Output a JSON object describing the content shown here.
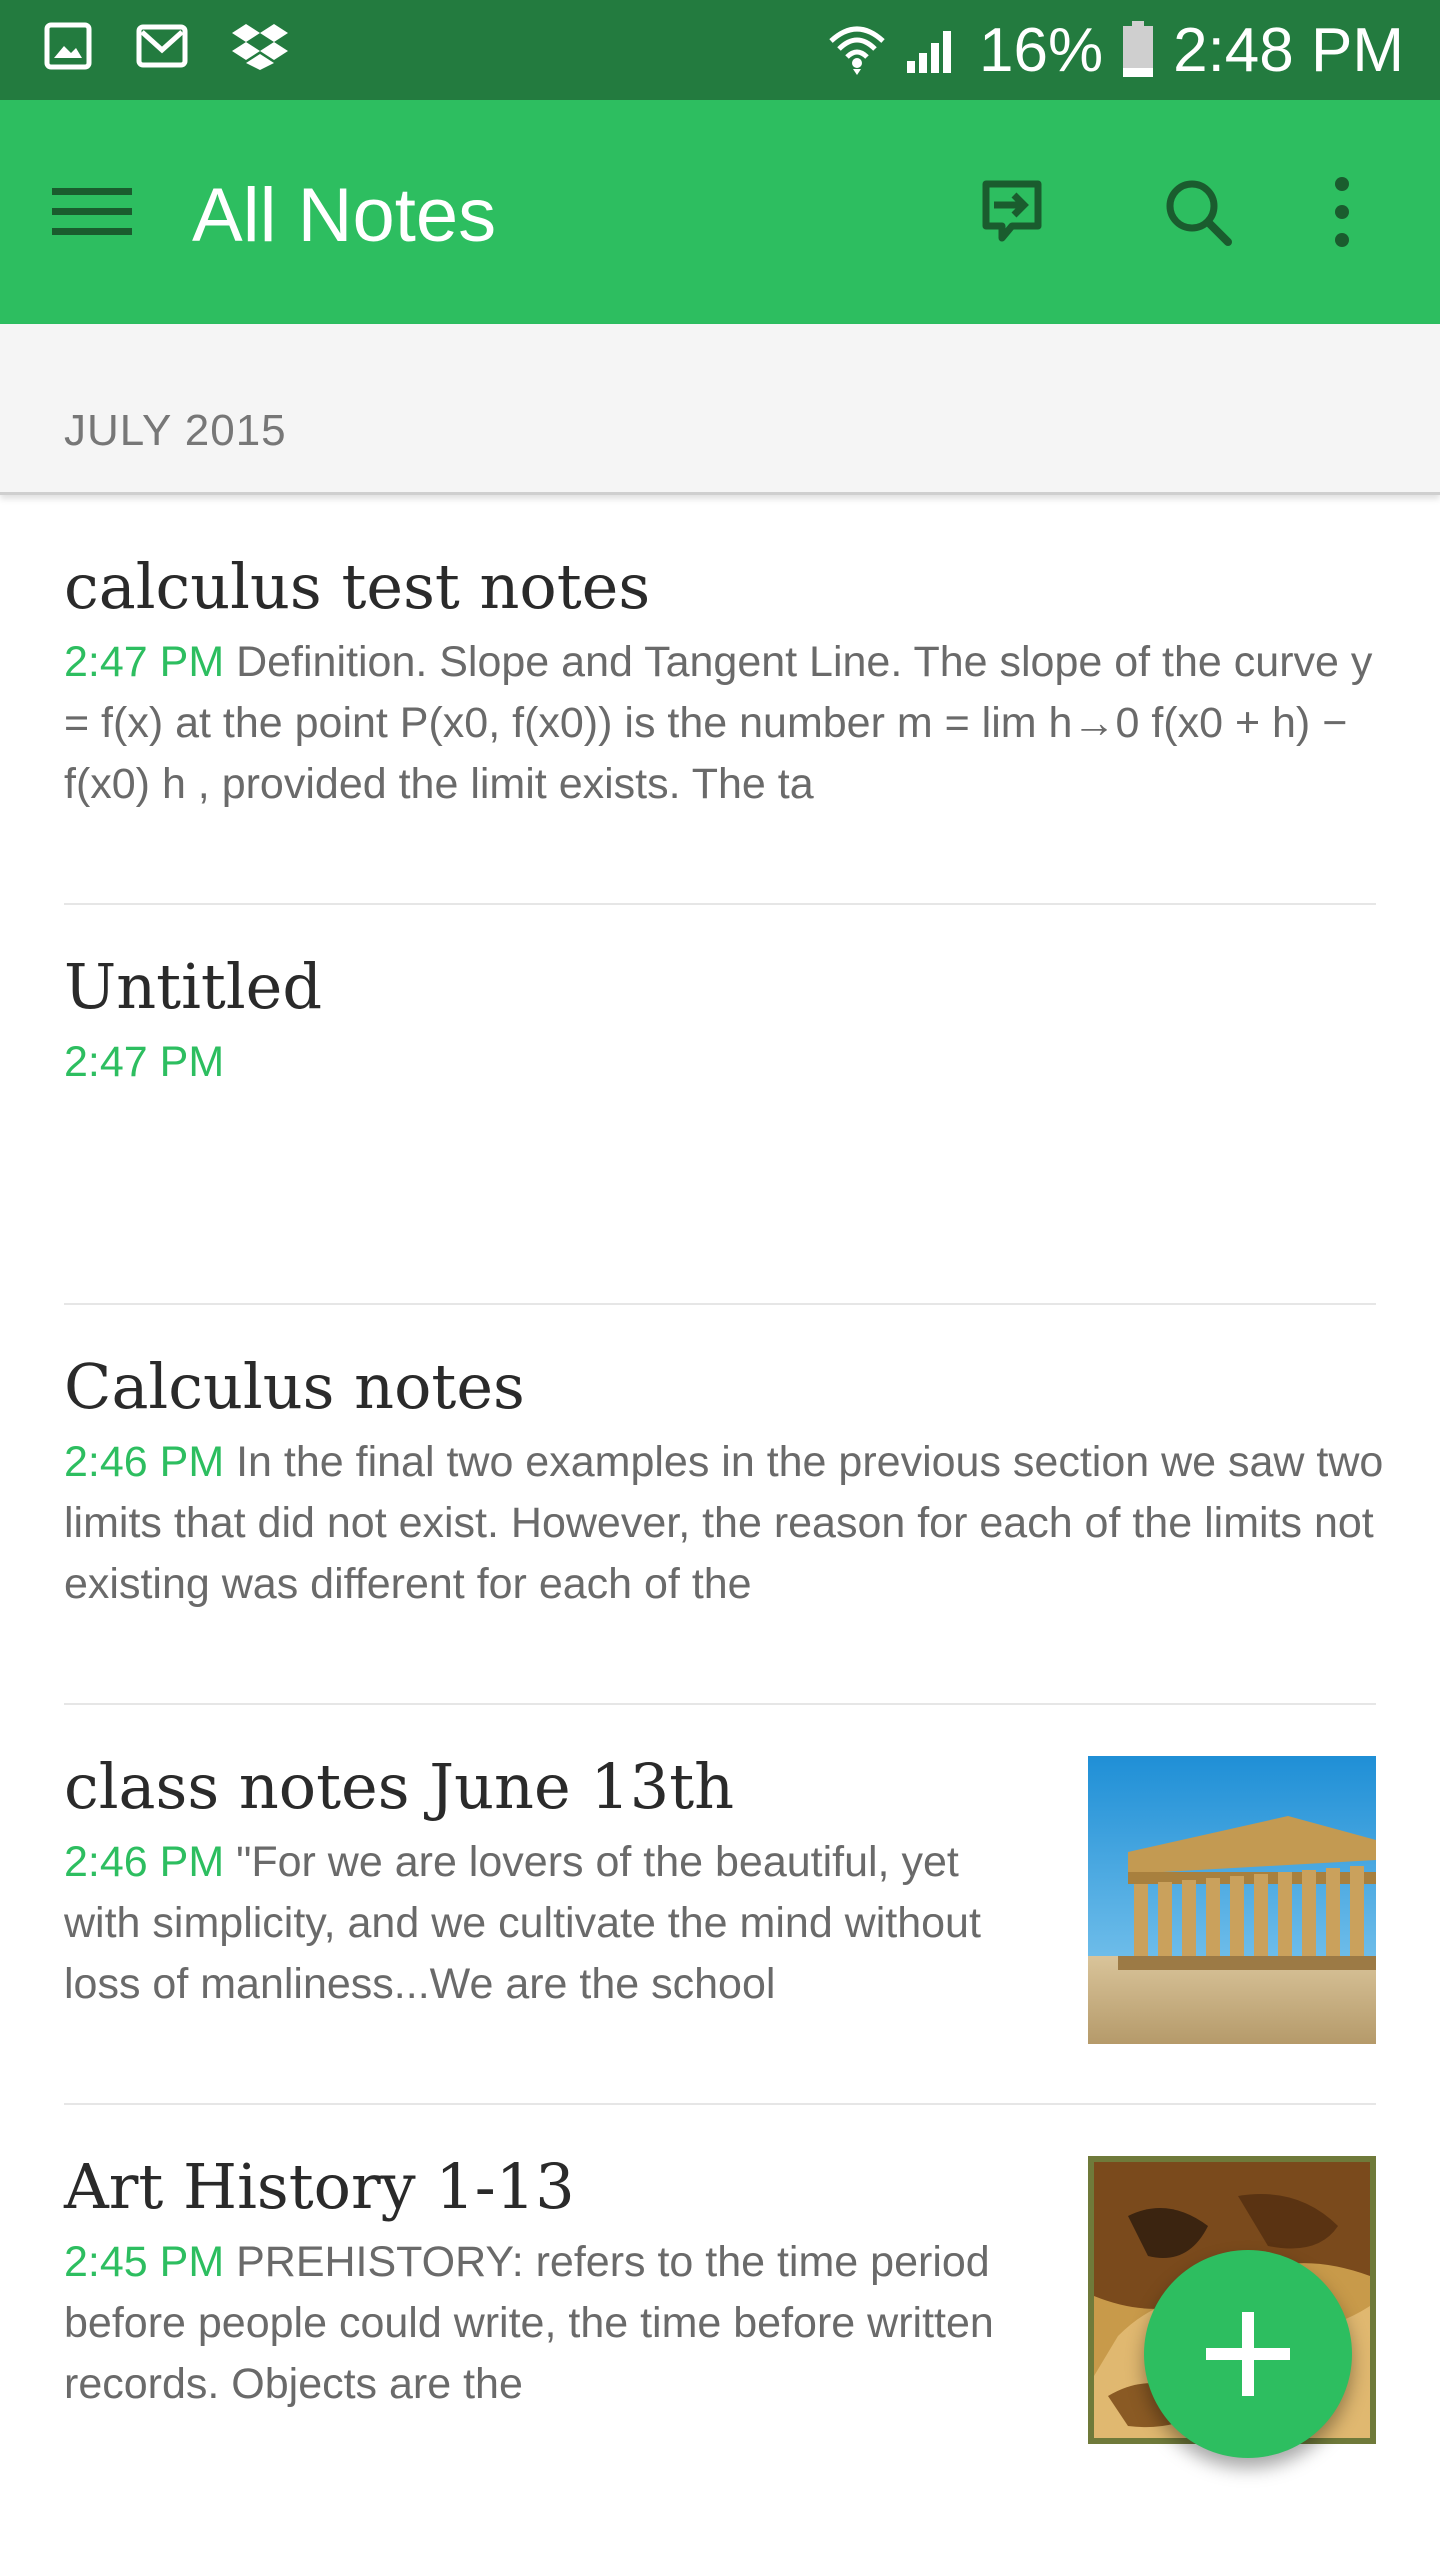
{
  "status_bar": {
    "battery": "16%",
    "time": "2:48 PM",
    "icons_left": [
      "gallery-icon",
      "gmail-icon",
      "dropbox-icon"
    ],
    "icons_right": [
      "wifi-icon",
      "signal-icon",
      "battery-icon"
    ]
  },
  "app_bar": {
    "title": "All Notes",
    "actions": [
      "sync-icon",
      "search-icon",
      "more-options-icon"
    ],
    "color": "#2dbe60"
  },
  "section": {
    "label": "JULY 2015"
  },
  "notes": [
    {
      "title": "calculus test notes",
      "time": "2:47 PM",
      "snippet": " Definition. Slope and Tangent Line. The slope of the curve y = f(x) at the point P(x0, f(x0)) is the number m = lim h→0 f(x0 + h) − f(x0) h , provided the limit exists. The ta"
    },
    {
      "title": "Untitled",
      "time": "2:47 PM",
      "snippet": ""
    },
    {
      "title": "Calculus notes",
      "time": "2:46 PM",
      "snippet": " In the final two examples in the previous section we saw two limits that did not exist. However, the reason for each of the limits not existing was different for each of the"
    },
    {
      "title": "class notes June 13th",
      "time": "2:46 PM",
      "snippet": " \"For we are lovers of the beautiful, yet with simplicity, and we cultivate the mind without loss of manliness...We are the school",
      "thumbnail": "parthenon-thumbnail"
    },
    {
      "title": "Art History 1-13",
      "time": "2:45 PM",
      "snippet": " PREHISTORY: refers to the time period before people could write, the time before written records. Objects are the",
      "thumbnail": "cave-painting-thumbnail"
    }
  ],
  "fab": {
    "icon": "plus-icon"
  },
  "colors": {
    "status_bar": "#237b3f",
    "accent": "#2dbe60",
    "time_text": "#2dbe60"
  }
}
